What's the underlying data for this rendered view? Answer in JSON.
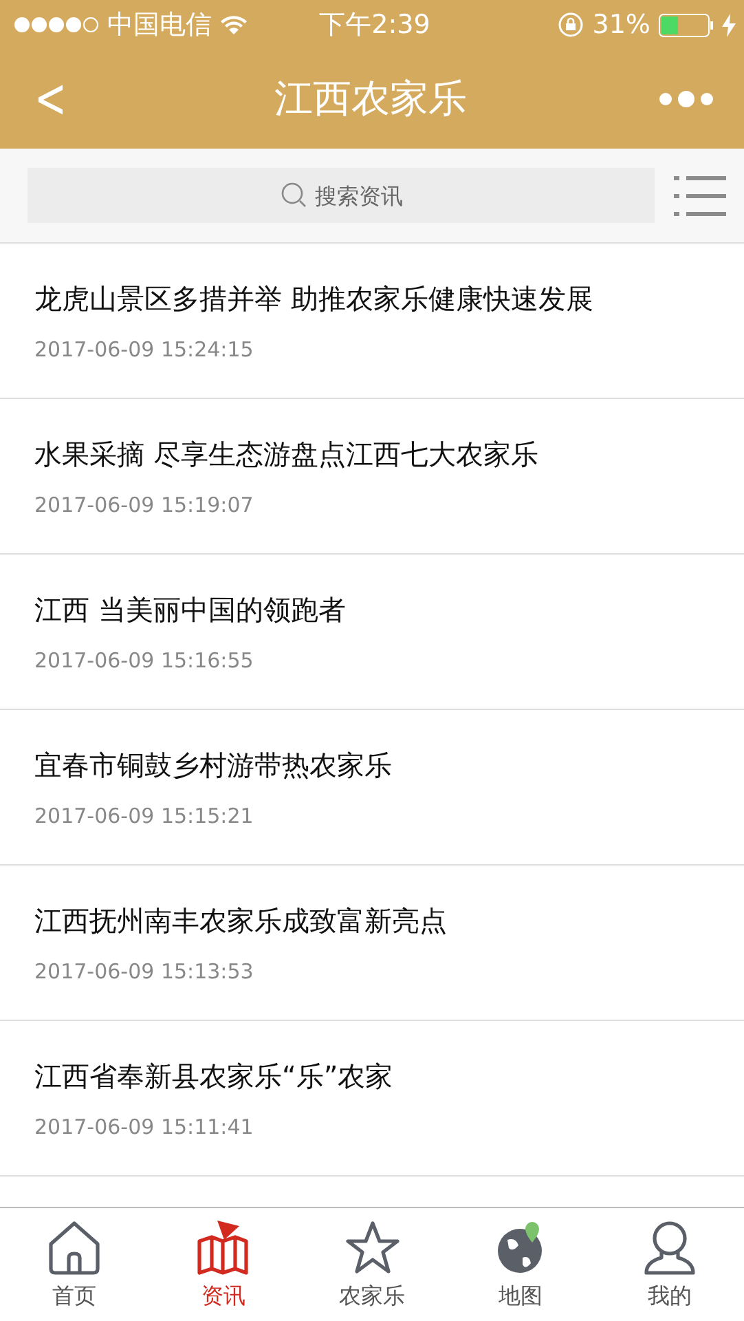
{
  "status_bar": {
    "carrier": "中国电信",
    "time": "下午2:39",
    "battery": "31%"
  },
  "nav": {
    "back": "<",
    "title": "江西农家乐"
  },
  "search": {
    "placeholder": "搜索资讯"
  },
  "articles": [
    {
      "title": "龙虎山景区多措并举 助推农家乐健康快速发展",
      "time": "2017-06-09 15:24:15"
    },
    {
      "title": "水果采摘 尽享生态游盘点江西七大农家乐",
      "time": "2017-06-09 15:19:07"
    },
    {
      "title": "江西 当美丽中国的领跑者",
      "time": "2017-06-09 15:16:55"
    },
    {
      "title": "宜春市铜鼓乡村游带热农家乐",
      "time": "2017-06-09 15:15:21"
    },
    {
      "title": "江西抚州南丰农家乐成致富新亮点",
      "time": "2017-06-09 15:13:53"
    },
    {
      "title": "江西省奉新县农家乐“乐”农家",
      "time": "2017-06-09 15:11:41"
    }
  ],
  "tabs": [
    {
      "kind": "home",
      "label": "首页",
      "selected": false
    },
    {
      "kind": "news",
      "label": "资讯",
      "selected": true
    },
    {
      "kind": "star",
      "label": "农家乐",
      "selected": false
    },
    {
      "kind": "globe",
      "label": "地图",
      "selected": false
    },
    {
      "kind": "person",
      "label": "我的",
      "selected": false
    }
  ]
}
